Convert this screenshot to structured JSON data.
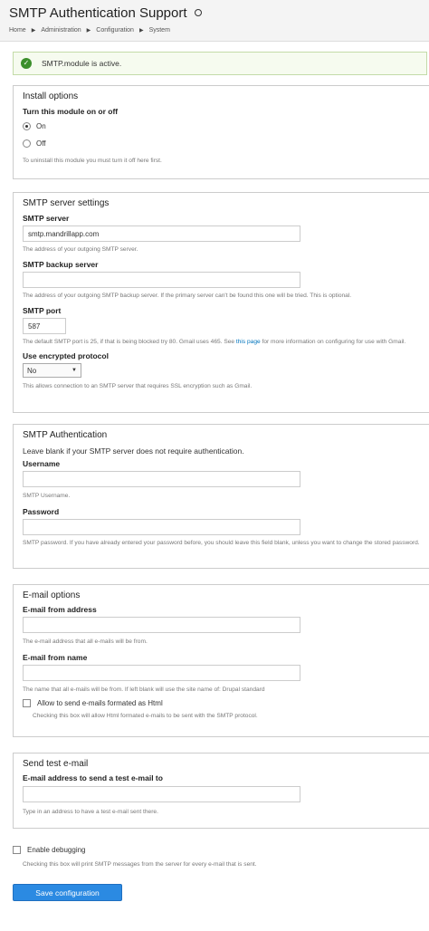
{
  "header": {
    "title": "SMTP Authentication Support",
    "shortcut_icon": "star-circle-icon",
    "breadcrumb": [
      "Home",
      "Administration",
      "Configuration",
      "System"
    ]
  },
  "status": {
    "message": "SMTP.module is active.",
    "icon": "check-circle-icon",
    "color": "#3c8f2c"
  },
  "install": {
    "legend": "Install options",
    "label": "Turn this module on or off",
    "options": [
      {
        "label": "On",
        "checked": true
      },
      {
        "label": "Off",
        "checked": false
      }
    ],
    "description": "To uninstall this module you must turn it off here first."
  },
  "server": {
    "legend": "SMTP server settings",
    "server_label": "SMTP server",
    "server_value": "smtp.mandrillapp.com",
    "server_desc": "The address of your outgoing SMTP server.",
    "backup_label": "SMTP backup server",
    "backup_value": "",
    "backup_desc": "The address of your outgoing SMTP backup server. If the primary server can't be found this one will be tried. This is optional.",
    "port_label": "SMTP port",
    "port_value": "587",
    "port_desc_before": "The default SMTP port is 25, if that is being blocked try 80. Gmail uses 465. See ",
    "port_desc_link": "this page",
    "port_desc_after": " for more information on configuring for use with Gmail.",
    "encrypt_label": "Use encrypted protocol",
    "encrypt_value": "No",
    "encrypt_desc": "This allows connection to an SMTP server that requires SSL encryption such as Gmail."
  },
  "auth": {
    "legend": "SMTP Authentication",
    "intro": "Leave blank if your SMTP server does not require authentication.",
    "username_label": "Username",
    "username_desc": "SMTP Username.",
    "password_label": "Password",
    "password_desc": "SMTP password. If you have already entered your password before, you should leave this field blank, unless you want to change the stored password."
  },
  "email": {
    "legend": "E-mail options",
    "from_address_label": "E-mail from address",
    "from_address_desc": "The e-mail address that all e-mails will be from.",
    "from_name_label": "E-mail from name",
    "from_name_desc": "The name that all e-mails will be from. If left blank will use the site name of: Drupal standard",
    "html_label": "Allow to send e-mails formated as Html",
    "html_desc": "Checking this box will allow Html formated e-mails to be sent with the SMTP protocol."
  },
  "test": {
    "legend": "Send test e-mail",
    "label": "E-mail address to send a test e-mail to",
    "desc": "Type in an address to have a test e-mail sent there."
  },
  "debug": {
    "label": "Enable debugging",
    "desc": "Checking this box will print SMTP messages from the server for every e-mail that is sent."
  },
  "save_label": "Save configuration",
  "colors": {
    "button": "#2b8ae2",
    "link": "#0074bd"
  }
}
